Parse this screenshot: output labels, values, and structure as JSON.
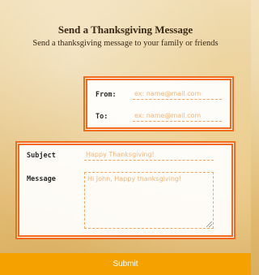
{
  "header": {
    "title": "Send a Thanksgiving Message",
    "subtitle": "Send a thanksgiving message to your family or friends"
  },
  "addresses": {
    "from_label": "From:",
    "from_placeholder": "ex: name@mail.com",
    "to_label": "To:",
    "to_placeholder": "ex: name@mail.com"
  },
  "message": {
    "subject_label": "Subject",
    "subject_placeholder": "Happy Thanksgiving!",
    "message_label": "Message",
    "message_placeholder": "Hi John, Happy thanksgiving!"
  },
  "submit_label": "Submit",
  "colors": {
    "accent": "#f26a1b",
    "submit_bg": "#f5a200",
    "placeholder": "#f5b57a"
  }
}
